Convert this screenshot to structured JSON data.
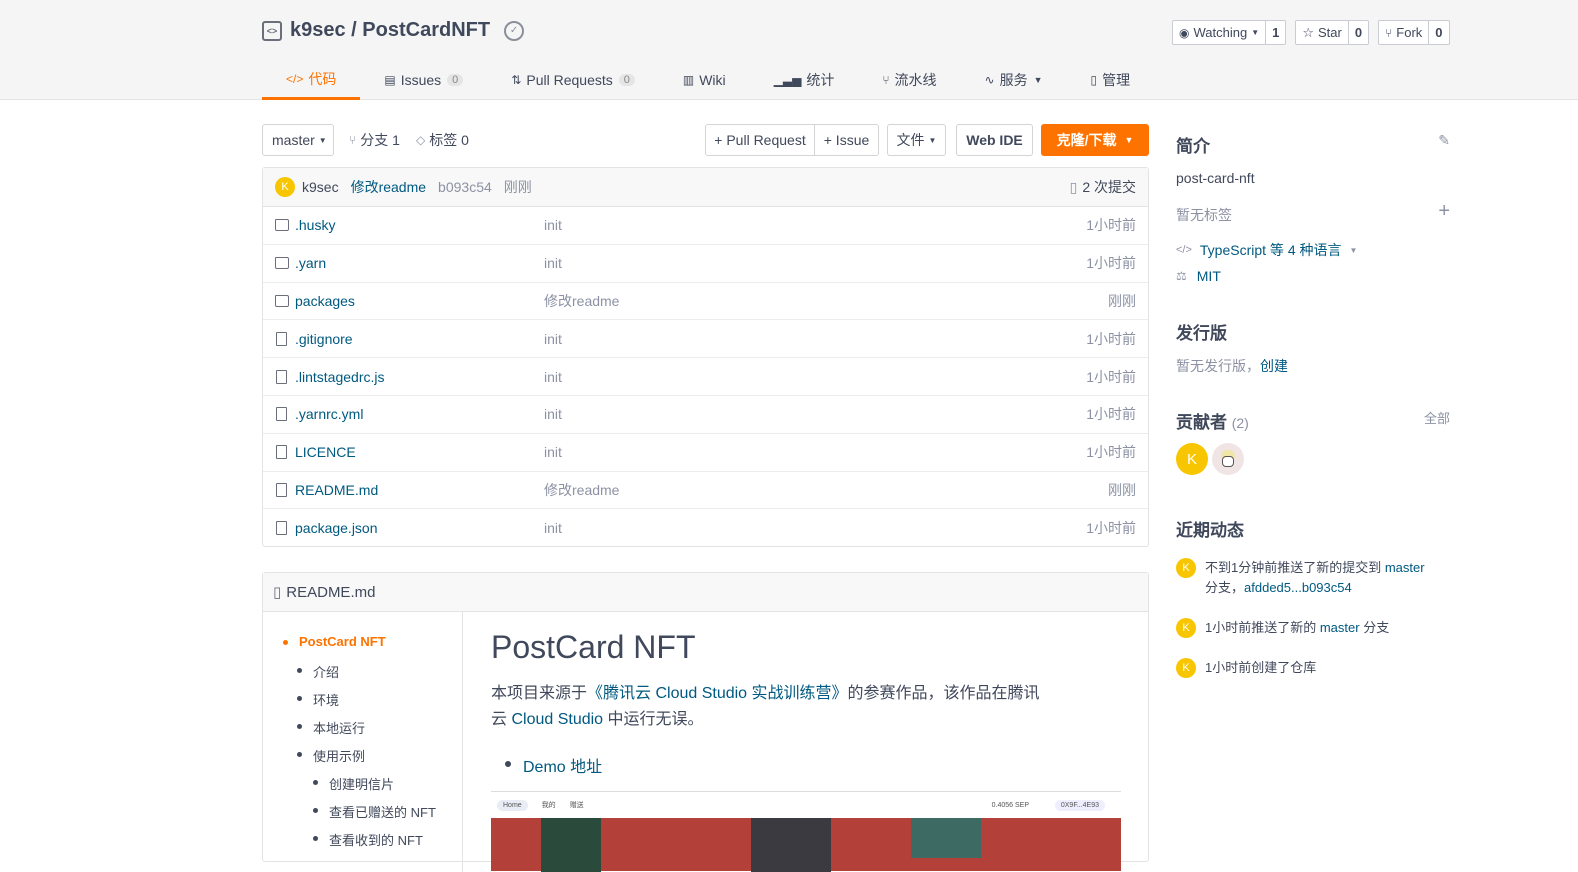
{
  "repo": {
    "owner": "k9sec",
    "separator": " / ",
    "name": "PostCardNFT"
  },
  "actions": {
    "watch_label": "Watching",
    "watch_count": "1",
    "star_label": "Star",
    "star_count": "0",
    "fork_label": "Fork",
    "fork_count": "0"
  },
  "tabs": [
    {
      "label": "代码",
      "count": null
    },
    {
      "label": "Issues",
      "count": "0"
    },
    {
      "label": "Pull Requests",
      "count": "0"
    },
    {
      "label": "Wiki",
      "count": null
    },
    {
      "label": "统计",
      "count": null
    },
    {
      "label": "流水线",
      "count": null
    },
    {
      "label": "服务",
      "count": null
    },
    {
      "label": "管理",
      "count": null
    }
  ],
  "toolbar": {
    "branch": "master",
    "branches": "分支 1",
    "tags": "标签 0",
    "pull_request": "+ Pull Request",
    "issue": "+ Issue",
    "file_menu": "文件",
    "web_ide": "Web IDE",
    "clone": "克隆/下载"
  },
  "commit": {
    "avatar_letter": "K",
    "author": "k9sec",
    "message": "修改readme",
    "hash": "b093c54",
    "time": "刚刚",
    "commits": "2 次提交"
  },
  "files": [
    {
      "type": "folder",
      "name": ".husky",
      "message": "init",
      "time": "1小时前"
    },
    {
      "type": "folder",
      "name": ".yarn",
      "message": "init",
      "time": "1小时前"
    },
    {
      "type": "folder",
      "name": "packages",
      "message": "修改readme",
      "time": "刚刚"
    },
    {
      "type": "file",
      "name": ".gitignore",
      "message": "init",
      "time": "1小时前"
    },
    {
      "type": "file",
      "name": ".lintstagedrc.js",
      "message": "init",
      "time": "1小时前"
    },
    {
      "type": "file",
      "name": ".yarnrc.yml",
      "message": "init",
      "time": "1小时前"
    },
    {
      "type": "file",
      "name": "LICENCE",
      "message": "init",
      "time": "1小时前"
    },
    {
      "type": "file",
      "name": "README.md",
      "message": "修改readme",
      "time": "刚刚"
    },
    {
      "type": "file",
      "name": "package.json",
      "message": "init",
      "time": "1小时前"
    }
  ],
  "readme": {
    "filename": "README.md",
    "toc": [
      "PostCard NFT",
      "介绍",
      "环境",
      "本地运行",
      "使用示例",
      "创建明信片",
      "查看已赠送的 NFT",
      "查看收到的 NFT"
    ],
    "title": "PostCard NFT",
    "para_prefix": "本项目来源于",
    "para_link": "《腾讯云 Cloud Studio 实战训练营》",
    "para_mid": "的参赛作品，该作品在腾讯云 ",
    "para_link2": "Cloud Studio",
    "para_suffix": " 中运行无误。",
    "demo_link": "Demo 地址",
    "shot_nav": [
      "Home",
      "我的",
      "赠送"
    ],
    "shot_balance": "0.4056 SEP",
    "shot_account": "0X9F...4E93"
  },
  "sidebar": {
    "intro_title": "简介",
    "description": "post-card-nft",
    "no_tags": "暂无标签",
    "languages": "TypeScript 等 4 种语言",
    "license": "MIT",
    "release_title": "发行版",
    "no_release": "暂无发行版，",
    "create": "创建",
    "contributors_title": "贡献者",
    "contributors_count": "(2)",
    "all": "全部",
    "contributor_letter": "K",
    "activity_title": "近期动态",
    "activities": [
      {
        "text": "不到1分钟前推送了新的提交到 ",
        "link": "master",
        "text2": "分支，",
        "link2": "afdded5...b093c54"
      },
      {
        "text": "1小时前推送了新的 ",
        "link": "master",
        "text2": " 分支"
      },
      {
        "text": "1小时前创建了仓库"
      }
    ]
  },
  "colors": {
    "accent": "#fe7300",
    "link": "#005980",
    "avatar": "#f7c600"
  }
}
